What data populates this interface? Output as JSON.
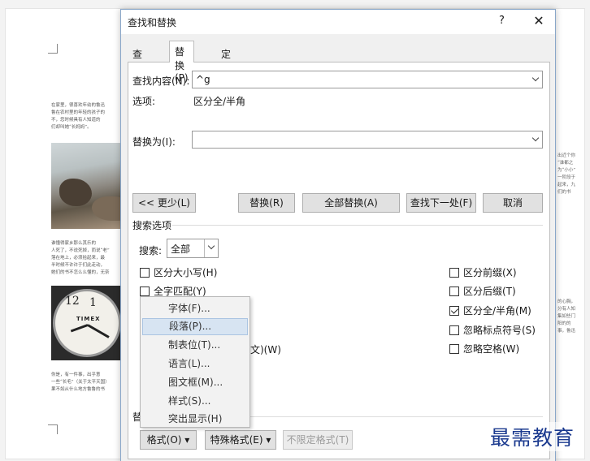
{
  "dialog": {
    "title": "查找和替换",
    "help": "?",
    "close": "✕"
  },
  "tabs": [
    {
      "label": "查找(D)"
    },
    {
      "label": "替换(P)"
    },
    {
      "label": "定位(G)"
    }
  ],
  "find": {
    "label": "查找内容(N):",
    "value": "^g",
    "options_label": "选项:",
    "options_value": "区分全/半角"
  },
  "replace": {
    "label": "替换为(I):",
    "value": ""
  },
  "buttons": {
    "less": "<< 更少(L)",
    "replace": "替换(R)",
    "replace_all": "全部替换(A)",
    "find_next": "查找下一处(F)",
    "cancel": "取消"
  },
  "search_options": {
    "title": "搜索选项",
    "search_label": "搜索:",
    "search_value": "全部",
    "left": [
      {
        "label": "区分大小写(H)",
        "checked": false
      },
      {
        "label": "全字匹配(Y)",
        "checked": false
      }
    ],
    "partial_hidden": "文)(W)",
    "right": [
      {
        "label": "区分前缀(X)",
        "checked": false
      },
      {
        "label": "区分后缀(T)",
        "checked": false
      },
      {
        "label": "区分全/半角(M)",
        "checked": true
      },
      {
        "label": "忽略标点符号(S)",
        "checked": false
      },
      {
        "label": "忽略空格(W)",
        "checked": false
      }
    ]
  },
  "replace_section_partial": "替",
  "bottom_buttons": {
    "format": "格式(O) ▾",
    "special": "特殊格式(E) ▾",
    "no_format": "不限定格式(T)"
  },
  "format_menu": [
    {
      "label": "字体(F)..."
    },
    {
      "label": "段落(P)..."
    },
    {
      "label": "制表位(T)..."
    },
    {
      "label": "语言(L)..."
    },
    {
      "label": "图文框(M)..."
    },
    {
      "label": "样式(S)..."
    },
    {
      "label": "突出显示(H)"
    }
  ],
  "format_menu_highlighted": "段落(P)...",
  "watermark": "最需教育",
  "document": {
    "p1": [
      "在家里，很喜欢年幼的鲁迅",
      "鲁在农村里的年轻的孩子的",
      "不，您时候具有人知道的",
      "们却叫她“长妈妈”。"
    ],
    "p2": [
      "谁懂得家乡那么其乐的",
      "人死了，不说死掉，而说“老”",
      "落在地上，必须拾起来，最",
      "半时候不许许于们此走动，",
      "她们的书不怎么么懂的，无奈"
    ],
    "p3": [
      "你是，有一件事，出乎意",
      "一些“长毛”（关于太平天国）",
      "果不如从什么地方鲁鲁的书"
    ],
    "right1": [
      "出近个你",
      "“谁都之",
      "为“小小”",
      "一阶段于",
      "起来，九",
      "们的书"
    ],
    "right2": [
      "的心胸，",
      "分有人知",
      "集如些门",
      "阳的的",
      "事，鲁迅"
    ],
    "clock_brand": "TIMEX",
    "clock_12": "12",
    "clock_1": "1"
  }
}
